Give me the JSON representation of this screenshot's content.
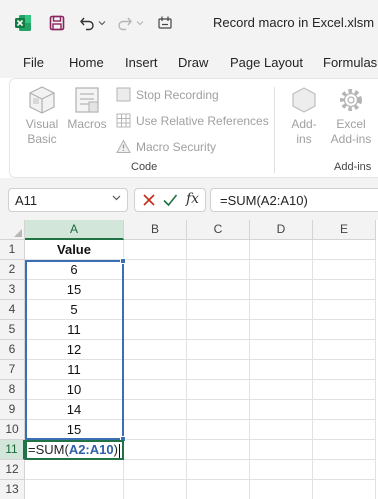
{
  "titlebar": {
    "doc_title": "Record macro in Excel.xlsm  -  E"
  },
  "tabs": [
    {
      "label": "File"
    },
    {
      "label": "Home"
    },
    {
      "label": "Insert"
    },
    {
      "label": "Draw"
    },
    {
      "label": "Page Layout"
    },
    {
      "label": "Formulas"
    }
  ],
  "ribbon": {
    "visual_basic": {
      "line1": "Visual",
      "line2": "Basic"
    },
    "macros": {
      "label": "Macros"
    },
    "stop_recording": {
      "label": "Stop Recording"
    },
    "relative_refs": {
      "label": "Use Relative References"
    },
    "macro_security": {
      "label": "Macro Security"
    },
    "code_group_label": "Code",
    "addins": {
      "line1": "Add-",
      "line2": "ins"
    },
    "excel_addins": {
      "line1": "Excel",
      "line2": "Add-ins"
    },
    "addins_group_label": "Add-ins"
  },
  "formula_bar": {
    "name_box": "A11",
    "fx_label": "fx",
    "formula": "=SUM(A2:A10)"
  },
  "columns": [
    "A",
    "B",
    "C",
    "D",
    "E"
  ],
  "rows": [
    "1",
    "2",
    "3",
    "4",
    "5",
    "6",
    "7",
    "8",
    "9",
    "10",
    "11",
    "12",
    "13"
  ],
  "cells": {
    "header": "Value",
    "values": [
      "6",
      "15",
      "5",
      "11",
      "12",
      "11",
      "10",
      "14",
      "15"
    ]
  },
  "active_cell": {
    "prefix": "=SUM(",
    "ref": "A2:A10",
    "suffix": ")"
  },
  "colors": {
    "excel_green": "#217346",
    "range_blue": "#3a6fb5",
    "ref_blue": "#2f5fa8",
    "cancel_red": "#c42b1c",
    "save_purple": "#8a2460"
  }
}
